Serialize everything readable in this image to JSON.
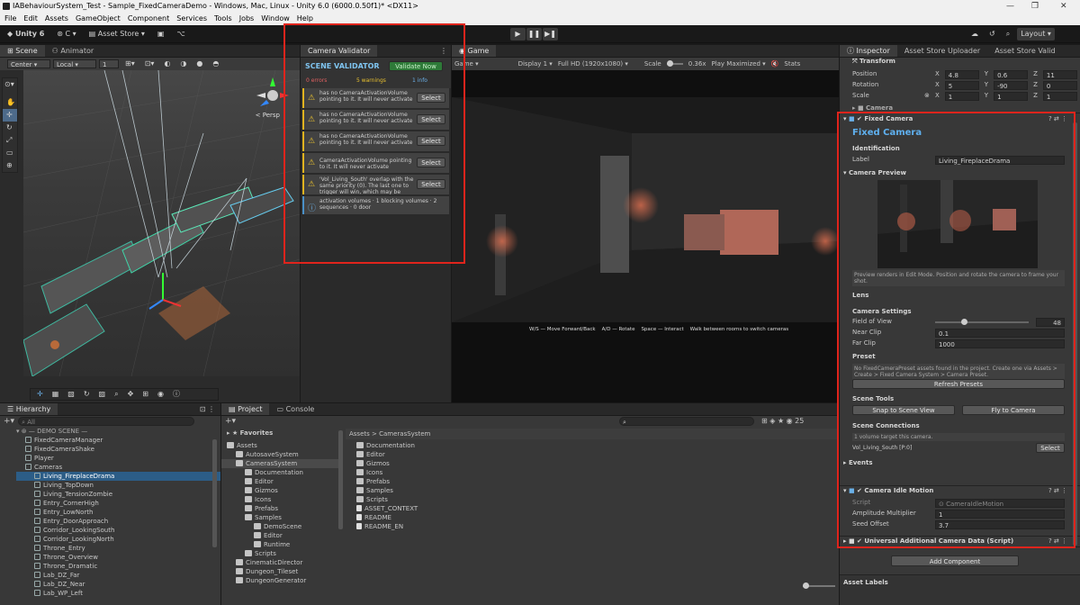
{
  "window": {
    "title": "IABehaviourSystem_Test - Sample_FixedCameraDemo - Windows, Mac, Linux - Unity 6.0 (6000.0.50f1)* <DX11>",
    "minimize": "—",
    "maximize": "❐",
    "close": "✕"
  },
  "menu": [
    "File",
    "Edit",
    "Assets",
    "GameObject",
    "Component",
    "Services",
    "Tools",
    "Jobs",
    "Window",
    "Help"
  ],
  "toolbar": {
    "unity_label": "Unity 6",
    "account": "C",
    "asset_store": "Asset Store",
    "layout": "Layout"
  },
  "scene_panel": {
    "tabs": [
      "Scene",
      "Animator"
    ],
    "pivot": "Center",
    "space": "Local",
    "grid_value": "1",
    "persp": "< Persp"
  },
  "validator": {
    "tab": "Camera Validator",
    "title": "SCENE VALIDATOR",
    "validate_btn": "Validate Now",
    "errors": "0 errors",
    "warnings": "5 warnings",
    "info": "1 info",
    "select_label": "Select",
    "warnings_list": [
      "has no CameraActivationVolume pointing to it. It will never activate",
      "has no CameraActivationVolume pointing to it. It will never activate",
      "has no CameraActivationVolume pointing to it. It will never activate",
      "CameraActivationVolume pointing to it. It will never activate",
      "'Vol_Living_South' overlap with the same priority (0). The last one to trigger will win, which may be"
    ],
    "info_text": "activation volumes · 1 blocking volumes · 2 sequences · 0 door"
  },
  "game": {
    "tab": "Game",
    "mode": "Game",
    "display": "Display 1",
    "resolution": "Full HD (1920x1080)",
    "scale_label": "Scale",
    "scale_value": "0.36x",
    "play_mode": "Play Maximized",
    "stats": "Stats",
    "hud": "W/S — Move Forward/Back    A/D — Rotate    Space — Interact    Walk between rooms to switch cameras"
  },
  "inspector": {
    "tabs": [
      "Inspector",
      "Asset Store Uploader",
      "Asset Store Valid"
    ],
    "transform": {
      "title": "Transform",
      "position_label": "Position",
      "rotation_label": "Rotation",
      "scale_label": "Scale",
      "position": [
        "4.8",
        "0.6",
        "11"
      ],
      "rotation": [
        "5",
        "-90",
        "0"
      ],
      "scale": [
        "1",
        "1",
        "1"
      ]
    },
    "camera_comp": "Camera",
    "fixed_camera": {
      "title": "Fixed Camera",
      "heading": "Fixed Camera",
      "identification": "Identification",
      "label_label": "Label",
      "label_value": "Living_FireplaceDrama",
      "preview_title": "Camera Preview",
      "preview_note": "Preview renders in Edit Mode. Position and rotate the camera to frame your shot.",
      "lens": "Lens",
      "camera_settings": "Camera Settings",
      "fov_label": "Field of View",
      "fov_value": "48",
      "fov_fraction": 0.28,
      "near_label": "Near Clip",
      "near_value": "0.1",
      "far_label": "Far Clip",
      "far_value": "1000",
      "preset": "Preset",
      "preset_note": "No FixedCameraPreset assets found in the project. Create one via Assets > Create > Fixed Camera System > Camera Preset.",
      "refresh_btn": "Refresh Presets",
      "scene_tools": "Scene Tools",
      "snap_btn": "Snap to Scene View",
      "fly_btn": "Fly to Camera",
      "scene_connections": "Scene Connections",
      "volumes_note": "1 volume target this camera.",
      "volume_name": "Vol_Living_South  [P:0]",
      "select_btn": "Select",
      "events": "Events"
    },
    "idle": {
      "title": "Camera Idle Motion",
      "script_label": "Script",
      "script_value": "CameraIdleMotion",
      "amp_label": "Amplitude Multiplier",
      "amp_value": "1",
      "seed_label": "Seed Offset",
      "seed_value": "3.7"
    },
    "urp": "Universal Additional Camera Data (Script)",
    "add_component": "Add Component",
    "asset_labels": "Asset Labels"
  },
  "hierarchy": {
    "tab": "Hierarchy",
    "search_placeholder": "All",
    "scene_header": "DEMO SCENE",
    "items": [
      {
        "label": "FixedCameraManager",
        "indent": 1,
        "selected": false
      },
      {
        "label": "FixedCameraShake",
        "indent": 1,
        "selected": false
      },
      {
        "label": "Player",
        "indent": 1,
        "selected": false
      },
      {
        "label": "Cameras",
        "indent": 1,
        "selected": false
      },
      {
        "label": "Living_FireplaceDrama",
        "indent": 2,
        "selected": true
      },
      {
        "label": "Living_TopDown",
        "indent": 2,
        "selected": false
      },
      {
        "label": "Living_TensionZombie",
        "indent": 2,
        "selected": false
      },
      {
        "label": "Entry_CornerHigh",
        "indent": 2,
        "selected": false
      },
      {
        "label": "Entry_LowNorth",
        "indent": 2,
        "selected": false
      },
      {
        "label": "Entry_DoorApproach",
        "indent": 2,
        "selected": false
      },
      {
        "label": "Corridor_LookingSouth",
        "indent": 2,
        "selected": false
      },
      {
        "label": "Corridor_LookingNorth",
        "indent": 2,
        "selected": false
      },
      {
        "label": "Throne_Entry",
        "indent": 2,
        "selected": false
      },
      {
        "label": "Throne_Overview",
        "indent": 2,
        "selected": false
      },
      {
        "label": "Throne_Dramatic",
        "indent": 2,
        "selected": false
      },
      {
        "label": "Lab_DZ_Far",
        "indent": 2,
        "selected": false
      },
      {
        "label": "Lab_DZ_Near",
        "indent": 2,
        "selected": false
      },
      {
        "label": "Lab_WP_Left",
        "indent": 2,
        "selected": false
      }
    ]
  },
  "project": {
    "tabs": [
      "Project",
      "Console"
    ],
    "favorites": "Favorites",
    "breadcrumb": "Assets > CamerasSystem",
    "tree": [
      {
        "label": "Assets",
        "indent": 0
      },
      {
        "label": "AutosaveSystem",
        "indent": 1
      },
      {
        "label": "CamerasSystem",
        "indent": 1
      },
      {
        "label": "Documentation",
        "indent": 2
      },
      {
        "label": "Editor",
        "indent": 2
      },
      {
        "label": "Gizmos",
        "indent": 2
      },
      {
        "label": "Icons",
        "indent": 2
      },
      {
        "label": "Prefabs",
        "indent": 2
      },
      {
        "label": "Samples",
        "indent": 2
      },
      {
        "label": "DemoScene",
        "indent": 3
      },
      {
        "label": "Editor",
        "indent": 3
      },
      {
        "label": "Runtime",
        "indent": 3
      },
      {
        "label": "Scripts",
        "indent": 2
      },
      {
        "label": "CinematicDirector",
        "indent": 1
      },
      {
        "label": "Dungeon_Tileset",
        "indent": 1
      },
      {
        "label": "DungeonGenerator",
        "indent": 1
      }
    ],
    "contents": [
      "Documentation",
      "Editor",
      "Gizmos",
      "Icons",
      "Prefabs",
      "Samples",
      "Scripts",
      "ASSET_CONTEXT",
      "README",
      "README_EN"
    ]
  }
}
